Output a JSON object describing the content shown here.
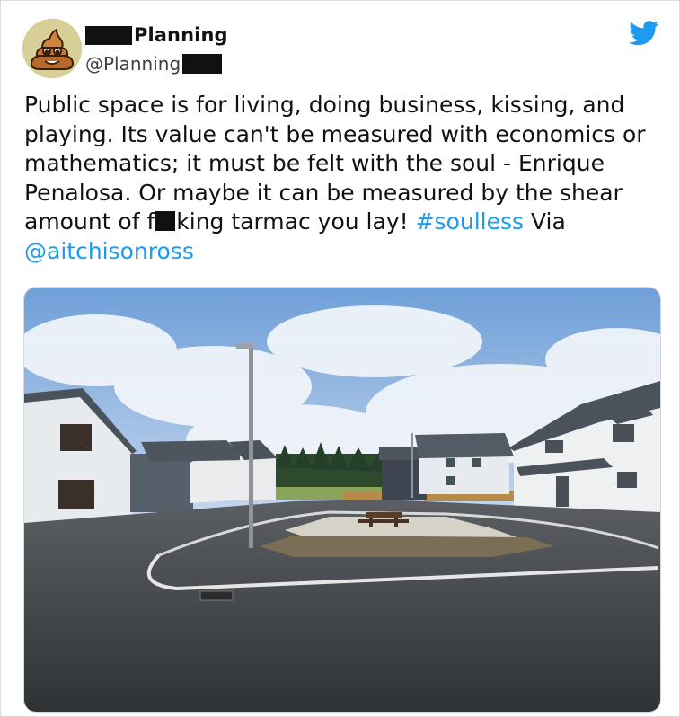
{
  "author": {
    "name": "Planning",
    "handle": "@Planning",
    "avatar_icon": "poop-emoji-icon"
  },
  "platform_icon": "twitter-bird-icon",
  "tweet": {
    "part1": "Public space is for living, doing business, kissing, and playing. Its value can't be measured with economics or mathematics; it must be felt with the soul - Enrique Penalosa. Or maybe it can be measured by the shear amount of f",
    "part2": "king tarmac you lay! ",
    "hashtag": "#soulless",
    "part3": " Via ",
    "mention": "@aitchisonross"
  },
  "colors": {
    "link": "#1d9bf0",
    "twitter_blue": "#1d9bf0"
  }
}
